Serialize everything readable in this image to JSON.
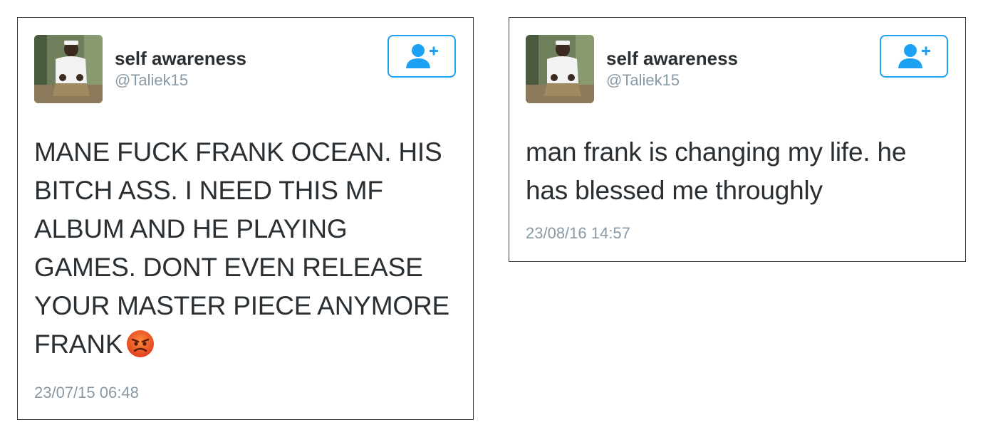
{
  "tweets": [
    {
      "display_name": "self awareness",
      "handle": "@Taliek15",
      "text": "MANE FUCK FRANK OCEAN. HIS BITCH ASS. I NEED THIS MF ALBUM AND HE PLAYING GAMES. DONT EVEN RELEASE YOUR MASTER PIECE ANYMORE FRANK",
      "emoji": "angry-face-emoji",
      "timestamp": "23/07/15 06:48",
      "follow_icon": "add-user-icon"
    },
    {
      "display_name": "self awareness",
      "handle": "@Taliek15",
      "text": "man frank is changing my life. he has blessed me throughly",
      "timestamp": "23/08/16 14:57",
      "follow_icon": "add-user-icon"
    }
  ],
  "colors": {
    "accent": "#1da1f2",
    "text": "#292f33",
    "secondary": "#8899a6",
    "border": "#3a3a3a"
  }
}
